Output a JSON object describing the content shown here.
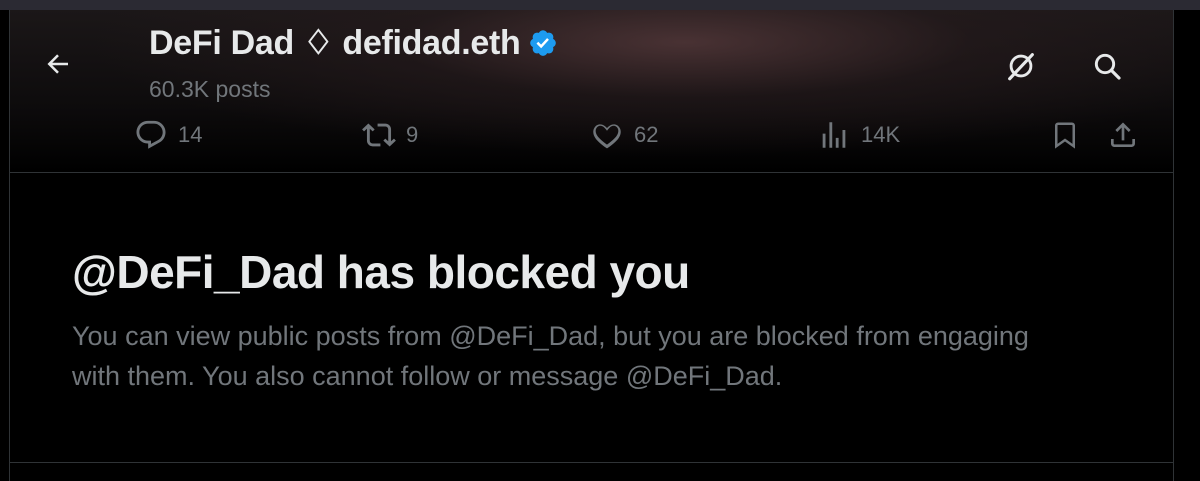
{
  "header": {
    "display_name": "DeFi Dad ♢ defidad.eth",
    "post_count": "60.3K posts"
  },
  "icons": {
    "back": "arrow-left-icon",
    "verified": "verified-badge-icon",
    "grok": "grok-icon",
    "search": "search-icon",
    "reply": "reply-icon",
    "repost": "repost-icon",
    "like": "like-icon",
    "views": "views-icon",
    "bookmark": "bookmark-icon",
    "share": "share-icon"
  },
  "engagement": {
    "replies": "14",
    "reposts": "9",
    "likes": "62",
    "views": "14K"
  },
  "blocked": {
    "heading": "@DeFi_Dad has blocked you",
    "message": "You can view public posts from @DeFi_Dad, but you are blocked from engaging with them. You also cannot follow or message @DeFi_Dad."
  },
  "colors": {
    "background": "#000000",
    "text_primary": "#e7e9ea",
    "text_secondary": "#71767b",
    "verified_blue": "#1d9bf0",
    "divider": "#2f3336"
  }
}
